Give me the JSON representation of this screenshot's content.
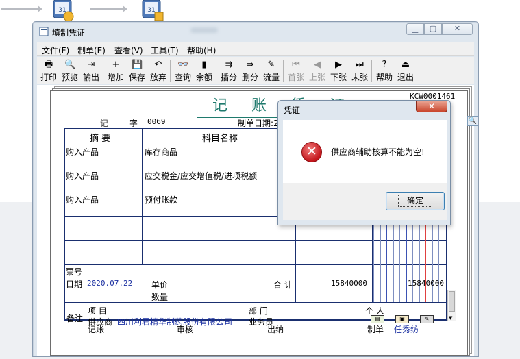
{
  "window": {
    "title": "填制凭证"
  },
  "menu": [
    "文件(F)",
    "制单(E)",
    "查看(V)",
    "工具(T)",
    "帮助(H)"
  ],
  "toolbar": [
    {
      "label": "打印",
      "icon": "printer-icon",
      "glyph": "🖶",
      "enabled": true
    },
    {
      "label": "预览",
      "icon": "preview-icon",
      "glyph": "🔍",
      "enabled": true
    },
    {
      "label": "输出",
      "icon": "export-icon",
      "glyph": "⇥",
      "enabled": true
    },
    {
      "label": "增加",
      "icon": "add-icon",
      "glyph": "+",
      "enabled": true
    },
    {
      "label": "保存",
      "icon": "save-icon",
      "glyph": "💾",
      "enabled": true
    },
    {
      "label": "放弃",
      "icon": "undo-icon",
      "glyph": "↶",
      "enabled": true
    },
    {
      "label": "查询",
      "icon": "binoculars-icon",
      "glyph": "👓",
      "enabled": true
    },
    {
      "label": "余额",
      "icon": "balance-chart-icon",
      "glyph": "▮",
      "enabled": true
    },
    {
      "label": "插分",
      "icon": "insert-row-icon",
      "glyph": "⇉",
      "enabled": true
    },
    {
      "label": "删分",
      "icon": "delete-row-icon",
      "glyph": "⇛",
      "enabled": true
    },
    {
      "label": "流量",
      "icon": "cashflow-icon",
      "glyph": "✎",
      "enabled": true
    },
    {
      "label": "首张",
      "icon": "first-record-icon",
      "glyph": "⏮",
      "enabled": false
    },
    {
      "label": "上张",
      "icon": "prev-record-icon",
      "glyph": "◀",
      "enabled": false
    },
    {
      "label": "下张",
      "icon": "next-record-icon",
      "glyph": "▶",
      "enabled": true
    },
    {
      "label": "末张",
      "icon": "last-record-icon",
      "glyph": "⏭",
      "enabled": true
    },
    {
      "label": "帮助",
      "icon": "help-icon",
      "glyph": "?",
      "enabled": true
    },
    {
      "label": "退出",
      "icon": "exit-icon",
      "glyph": "⏏",
      "enabled": true
    }
  ],
  "voucher": {
    "title": "记 账 凭 证",
    "code": "KCW0001461",
    "type_label": "记",
    "zi_label": "字",
    "number": "0069",
    "date_label": "制单日期:2020.",
    "col_summary": "摘 要",
    "col_account": "科目名称",
    "rows": [
      {
        "summary": "购入产品",
        "account": "库存商品"
      },
      {
        "summary": "购入产品",
        "account": "应交税金/应交增值税/进项税额"
      },
      {
        "summary": "购入产品",
        "account": "预付账款"
      },
      {
        "summary": "",
        "account": ""
      },
      {
        "summary": "",
        "account": ""
      }
    ],
    "ticket_label": "票号",
    "date_field_label": "日期",
    "date_value": "2020.07.22",
    "price_label": "单价",
    "qty_label": "数量",
    "total_label": "合 计",
    "debit_total": "15840000",
    "credit_total": "15840000",
    "remark_label": "备注",
    "project_label": "项  目",
    "dept_label": "部  门",
    "person_label": "个  人",
    "supplier_label": "供应商",
    "supplier_value": "四川利君精华制药股份有限公司",
    "salesman_label": "业务员",
    "sign_bookkeeping": "记账",
    "sign_review": "审核",
    "sign_cashier": "出纳",
    "sign_maker_label": "制单",
    "sign_maker_value": "任秀纺"
  },
  "dialog": {
    "title": "凭证",
    "message": "供应商辅助核算不能为空!",
    "ok_label": "确定"
  },
  "colors": {
    "title_green": "#1f7a6d",
    "grid_blue": "#1a2f6f",
    "value_blue": "#1a2fa0",
    "error_red": "#c4161c"
  }
}
